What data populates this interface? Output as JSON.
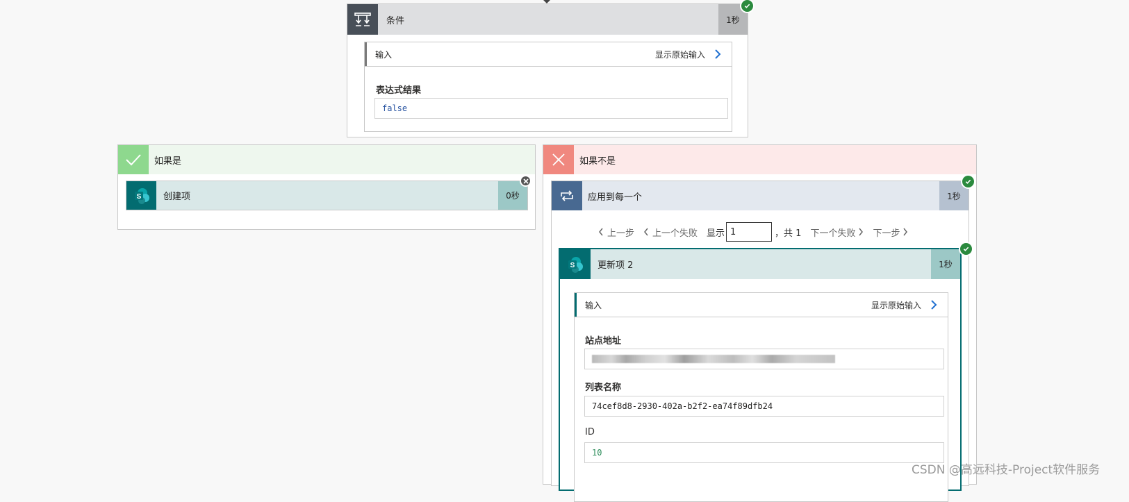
{
  "condition": {
    "title": "条件",
    "duration": "1秒",
    "inputs": {
      "label": "输入",
      "show_raw": "显示原始输入",
      "field_label": "表达式结果",
      "field_value": "false"
    }
  },
  "if_yes": {
    "title": "如果是",
    "action": {
      "title": "创建项",
      "duration": "0秒"
    }
  },
  "if_no": {
    "title": "如果不是",
    "loop": {
      "title": "应用到每一个",
      "duration": "1秒",
      "pager": {
        "prev": "上一步",
        "prev_fail": "上一个失败",
        "show": "显示",
        "current": "1",
        "total": "，共 1",
        "next_fail": "下一个失败",
        "next": "下一步"
      },
      "action": {
        "title": "更新项 2",
        "duration": "1秒",
        "inputs": {
          "label": "输入",
          "show_raw": "显示原始输入",
          "site_label": "站点地址",
          "list_label": "列表名称",
          "list_value": "74cef8d8-2930-402a-b2f2-ea74f89dfb24",
          "id_label": "ID",
          "id_value": "10"
        }
      }
    }
  },
  "watermark": "CSDN @高远科技-Project软件服务",
  "colors": {
    "condition_icon_bg": "#484f58",
    "yes_green": "#8ed88e",
    "no_red": "#f0887f",
    "loop_blue": "#486991",
    "sharepoint_teal": "#036c70",
    "success_green": "#2b8a3e",
    "value_blue": "#2a55a2",
    "id_green": "#2c8c5a"
  }
}
